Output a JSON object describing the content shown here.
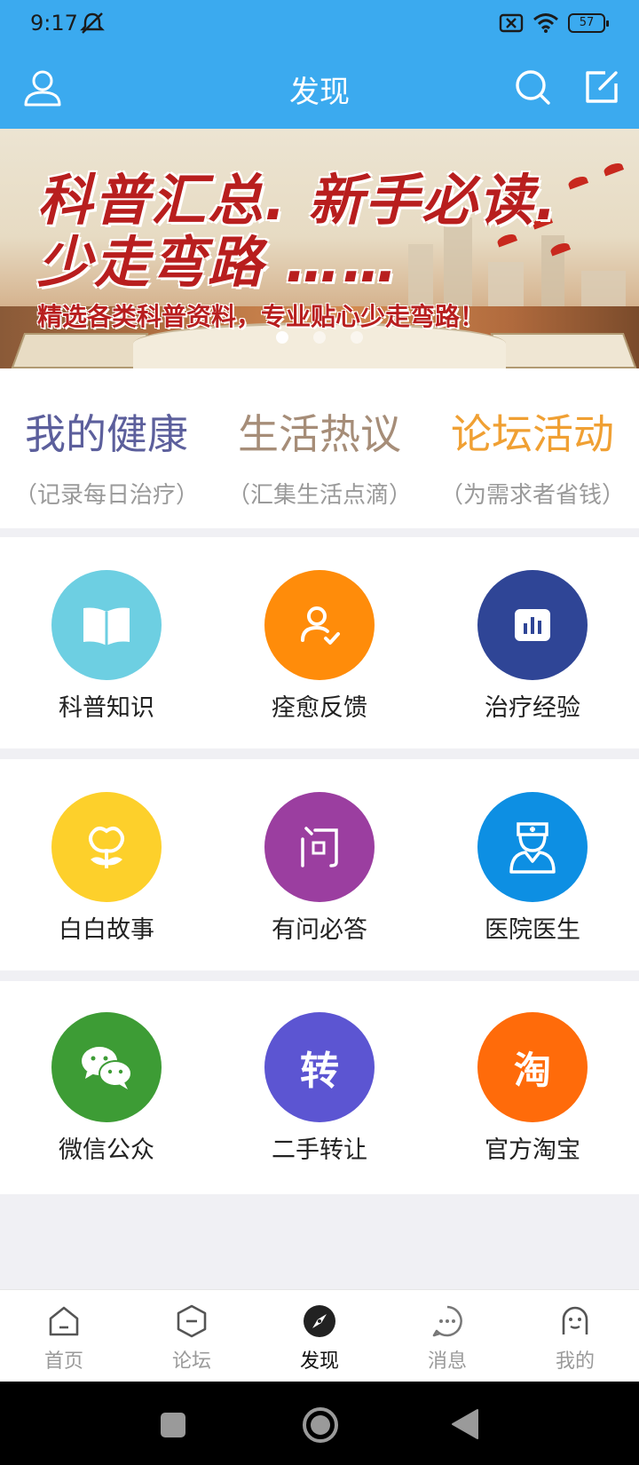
{
  "status_bar": {
    "time": "9:17",
    "battery": "57"
  },
  "header": {
    "title": "发现"
  },
  "banner": {
    "line1": "科普汇总. 新手必读.",
    "line2": "少走弯路 ……",
    "subtitle": "精选各类科普资料，专业贴心少走弯路！"
  },
  "categories": [
    {
      "title": "我的健康",
      "subtitle": "（记录每日治疗）",
      "color": "#5c5f9c"
    },
    {
      "title": "生活热议",
      "subtitle": "（汇集生活点滴）",
      "color": "#a68d78"
    },
    {
      "title": "论坛活动",
      "subtitle": "（为需求者省钱）",
      "color": "#f0a033"
    }
  ],
  "grid": [
    [
      {
        "label": "科普知识",
        "icon": "book-icon",
        "color": "#6dcfe2"
      },
      {
        "label": "痊愈反馈",
        "icon": "user-check-icon",
        "color": "#ff8c0a"
      },
      {
        "label": "治疗经验",
        "icon": "chart-icon",
        "color": "#2f4596"
      }
    ],
    [
      {
        "label": "白白故事",
        "icon": "flower-icon",
        "color": "#fdd02b"
      },
      {
        "label": "有问必答",
        "icon": "question-icon",
        "color": "#9b3ea0"
      },
      {
        "label": "医院医生",
        "icon": "doctor-icon",
        "color": "#0d8fe3"
      }
    ],
    [
      {
        "label": "微信公众",
        "icon": "wechat-icon",
        "color": "#3d9c35"
      },
      {
        "label": "二手转让",
        "icon_text": "转",
        "icon": "transfer-icon",
        "color": "#5c55d2"
      },
      {
        "label": "官方淘宝",
        "icon_text": "淘",
        "icon": "taobao-icon",
        "color": "#ff6b0a"
      }
    ]
  ],
  "bottom_nav": [
    {
      "label": "首页",
      "icon": "home-icon"
    },
    {
      "label": "论坛",
      "icon": "forum-icon"
    },
    {
      "label": "发现",
      "icon": "compass-icon",
      "active": true
    },
    {
      "label": "消息",
      "icon": "message-icon"
    },
    {
      "label": "我的",
      "icon": "profile-icon"
    }
  ]
}
